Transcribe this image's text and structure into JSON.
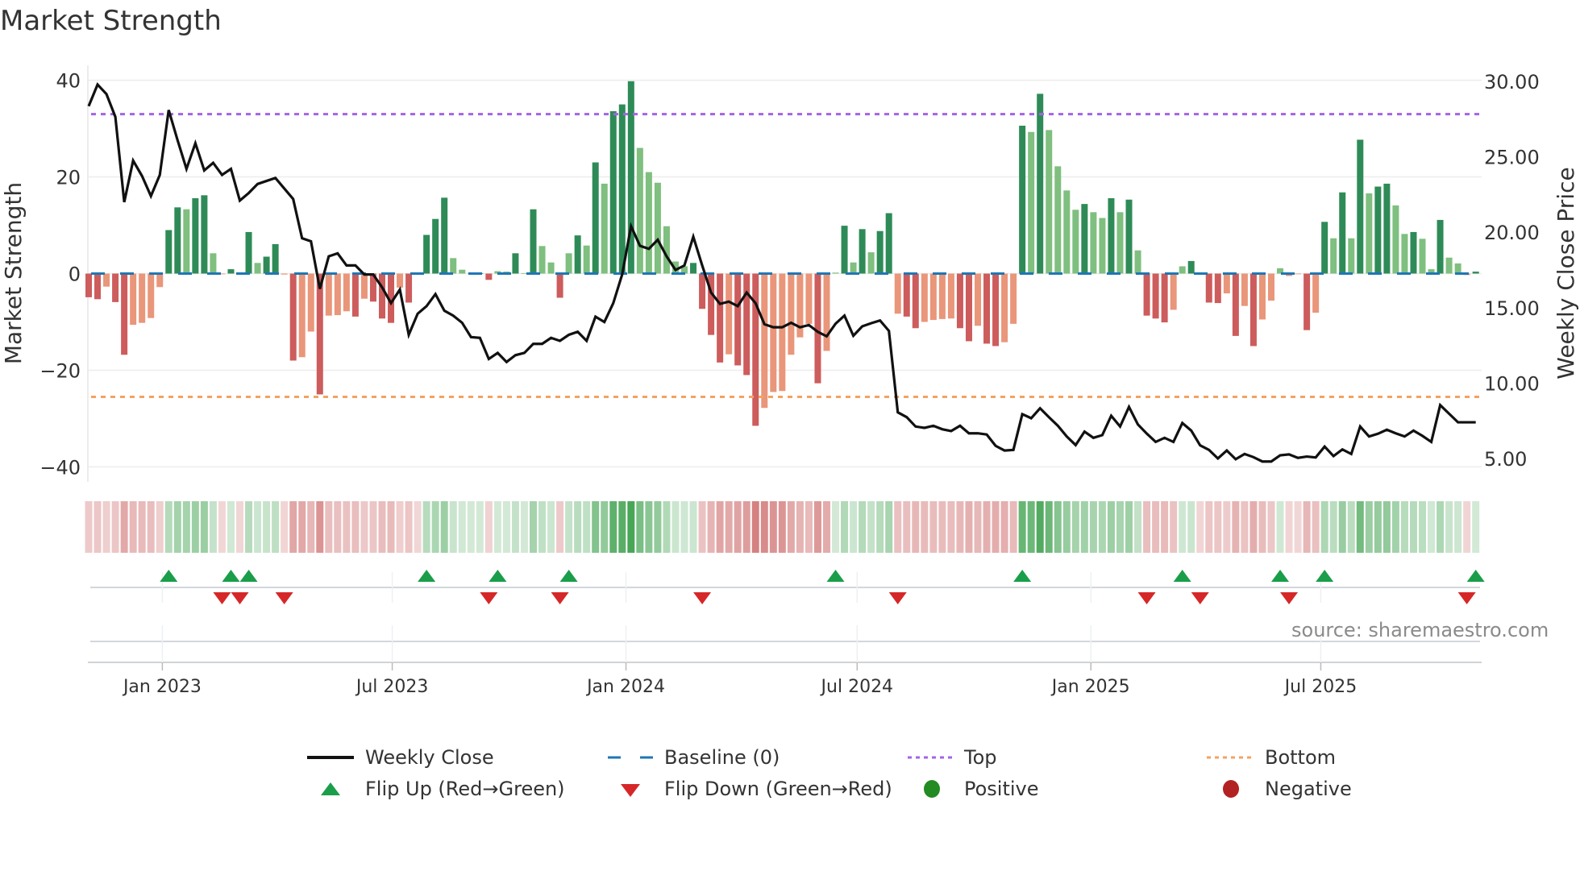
{
  "title": "Market Strength",
  "source": "source: sharemaestro.com",
  "colors": {
    "pos_strong": "#2e8b57",
    "pos_weak": "#7fbf7f",
    "neg_strong": "#cd5c5c",
    "neg_weak": "#e9967a",
    "close": "#111111",
    "baseline": "#1f77b4",
    "top": "#a463e6",
    "bottom": "#f4a261",
    "flip_up": "#1a9e4a",
    "flip_down": "#d62728",
    "positive": "#228b22",
    "negative": "#b22222"
  },
  "legend": [
    {
      "label": "Weekly Close",
      "icon": "solid-line"
    },
    {
      "label": "Baseline (0)",
      "icon": "dashed-line"
    },
    {
      "label": "Top",
      "icon": "dotted-line-purple"
    },
    {
      "label": "Bottom",
      "icon": "dotted-line-orange"
    },
    {
      "label": "Flip Up (Red→Green)",
      "icon": "triangle-up"
    },
    {
      "label": "Flip Down (Green→Red)",
      "icon": "triangle-down"
    },
    {
      "label": "Positive",
      "icon": "circle-green"
    },
    {
      "label": "Negative",
      "icon": "circle-red"
    }
  ],
  "chart_data": {
    "type": "bar",
    "title": "Market Strength",
    "ylabel": "Market Strength",
    "y2label": "Weekly Close Price",
    "ylim": [
      -43.1,
      43.1
    ],
    "y2lim": [
      3.45,
      31.07
    ],
    "yticks": [
      {
        "v": 40,
        "label": "40"
      },
      {
        "v": 20,
        "label": "20"
      },
      {
        "v": 0,
        "label": "0"
      },
      {
        "v": -20,
        "label": "−20"
      },
      {
        "v": -40,
        "label": "−40"
      }
    ],
    "y2ticks": [
      {
        "v": 30,
        "label": "30.00"
      },
      {
        "v": 25,
        "label": "25.00"
      },
      {
        "v": 20,
        "label": "20.00"
      },
      {
        "v": 15,
        "label": "15.00"
      },
      {
        "v": 10,
        "label": "10.00"
      },
      {
        "v": 5,
        "label": "5.00"
      }
    ],
    "xticks": [
      {
        "days": 58,
        "label": "Jan 2023"
      },
      {
        "days": 239,
        "label": "Jul 2023"
      },
      {
        "days": 423,
        "label": "Jan 2024"
      },
      {
        "days": 605,
        "label": "Jul 2024"
      },
      {
        "days": 789,
        "label": "Jan 2025"
      },
      {
        "days": 970,
        "label": "Jul 2025"
      }
    ],
    "start_date": "2022-11-04",
    "interval": "weekly",
    "top": 33.0,
    "bottom": -25.5,
    "baseline": 0,
    "strength": [
      -4.9,
      -5.3,
      -2.7,
      -5.9,
      -16.8,
      -10.6,
      -10.2,
      -9.2,
      -2.8,
      9.0,
      13.7,
      13.3,
      15.6,
      16.2,
      4.2,
      -0.1,
      0.9,
      -0.1,
      8.6,
      2.2,
      3.5,
      6.1,
      -0.2,
      -18.0,
      -17.3,
      -12.0,
      -25.0,
      -8.7,
      -8.6,
      -7.8,
      -8.9,
      -5.2,
      -5.8,
      -9.3,
      -10.2,
      -2.9,
      -6.0,
      -0.1,
      8.0,
      11.3,
      15.7,
      3.2,
      0.8,
      0.1,
      0.1,
      -1.3,
      0.5,
      0.4,
      4.2,
      0.1,
      13.3,
      5.7,
      2.3,
      -5.0,
      4.2,
      7.9,
      5.8,
      23.0,
      18.6,
      33.6,
      35.0,
      39.8,
      26.0,
      21.0,
      18.8,
      9.8,
      2.5,
      1.5,
      2.2,
      -7.3,
      -12.7,
      -18.4,
      -16.7,
      -19.0,
      -21.0,
      -31.5,
      -27.8,
      -24.5,
      -24.3,
      -16.8,
      -13.2,
      -10.4,
      -22.7,
      -16.0,
      0.2,
      9.9,
      2.3,
      9.2,
      4.4,
      8.8,
      12.5,
      -8.3,
      -8.9,
      -11.3,
      -10.0,
      -9.6,
      -9.4,
      -9.3,
      -11.3,
      -14.0,
      -10.8,
      -14.5,
      -15.0,
      -14.2,
      -10.4,
      30.6,
      29.3,
      37.2,
      29.7,
      22.2,
      17.2,
      13.2,
      14.4,
      12.7,
      11.5,
      15.6,
      12.7,
      15.3,
      4.8,
      -8.7,
      -9.3,
      -10.1,
      -7.5,
      1.5,
      2.6,
      -0.2,
      -6.0,
      -6.1,
      -4.1,
      -12.9,
      -6.7,
      -15.0,
      -9.5,
      -5.6,
      1.1,
      -0.5,
      -0.1,
      -11.7,
      -8.1,
      10.7,
      7.3,
      16.8,
      7.3,
      27.7,
      16.6,
      18.0,
      18.6,
      14.1,
      8.2,
      8.6,
      7.2,
      0.9,
      11.1,
      3.3,
      2.1,
      -0.3,
      0.4
    ],
    "close": [
      28.36,
      29.79,
      29.16,
      27.65,
      22.0,
      24.75,
      23.73,
      22.4,
      23.8,
      28.1,
      26.1,
      24.2,
      25.9,
      24.1,
      24.6,
      23.8,
      24.2,
      22.1,
      22.6,
      23.2,
      23.4,
      23.6,
      22.9,
      22.2,
      19.6,
      19.4,
      16.25,
      18.4,
      18.6,
      17.8,
      17.8,
      17.2,
      17.2,
      16.35,
      15.3,
      16.2,
      13.2,
      14.6,
      15.1,
      15.9,
      14.8,
      14.47,
      14.0,
      13.05,
      13.0,
      11.6,
      12.0,
      11.4,
      11.85,
      12.0,
      12.6,
      12.6,
      13.0,
      12.8,
      13.2,
      13.4,
      12.8,
      14.4,
      14.05,
      15.3,
      17.2,
      20.4,
      19.1,
      18.9,
      19.5,
      18.4,
      17.5,
      17.8,
      19.7,
      17.8,
      16.0,
      15.25,
      15.4,
      15.1,
      16.0,
      15.3,
      13.9,
      13.7,
      13.7,
      14.0,
      13.7,
      13.85,
      13.4,
      13.1,
      13.94,
      14.47,
      13.14,
      13.76,
      13.97,
      14.15,
      13.46,
      8.06,
      7.74,
      7.12,
      7.03,
      7.17,
      6.94,
      6.82,
      7.17,
      6.67,
      6.67,
      6.59,
      5.84,
      5.53,
      5.57,
      7.94,
      7.67,
      8.33,
      7.74,
      7.17,
      6.46,
      5.89,
      6.78,
      6.37,
      6.55,
      7.83,
      7.12,
      8.42,
      7.26,
      6.65,
      6.1,
      6.37,
      6.1,
      7.35,
      6.85,
      5.87,
      5.57,
      5.0,
      5.53,
      4.95,
      5.3,
      5.09,
      4.8,
      4.8,
      5.21,
      5.27,
      5.04,
      5.13,
      5.07,
      5.79,
      5.16,
      5.6,
      5.3,
      7.12,
      6.46,
      6.64,
      6.91,
      6.67,
      6.46,
      6.85,
      6.5,
      6.1,
      8.54,
      7.97,
      7.4,
      7.4,
      7.4
    ],
    "legend_position": "bottom"
  }
}
